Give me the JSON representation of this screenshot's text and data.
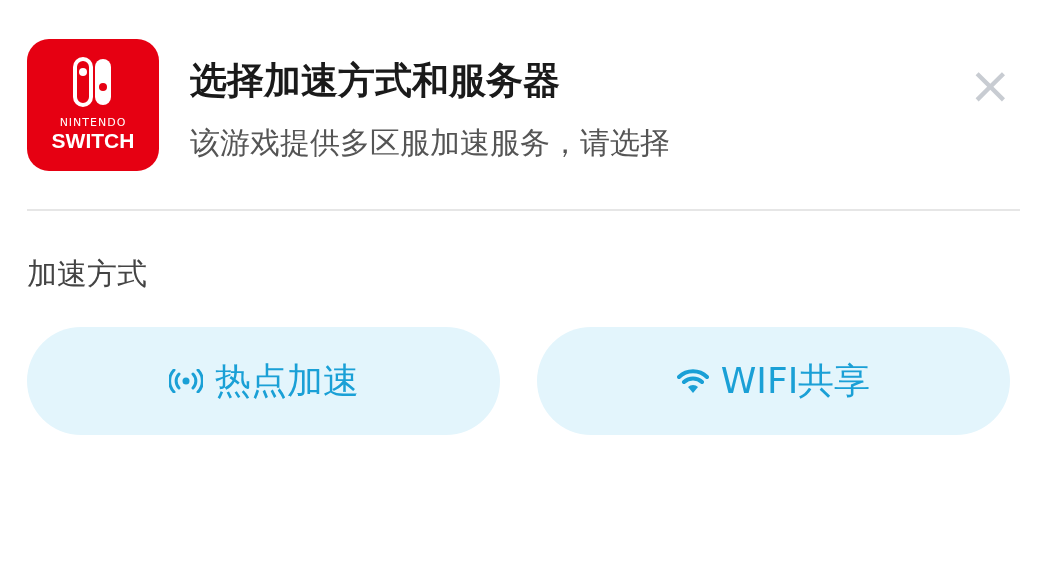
{
  "header": {
    "logo": {
      "line_1": "NINTENDO",
      "line_2": "SWITCH"
    },
    "title": "选择加速方式和服务器",
    "subtitle": "该游戏提供多区服加速服务，请选择",
    "close": "×"
  },
  "section": {
    "label": "加速方式"
  },
  "options": [
    {
      "kind": "hotspot",
      "label": "热点加速"
    },
    {
      "kind": "wifi",
      "label": "WIFI共享"
    }
  ]
}
